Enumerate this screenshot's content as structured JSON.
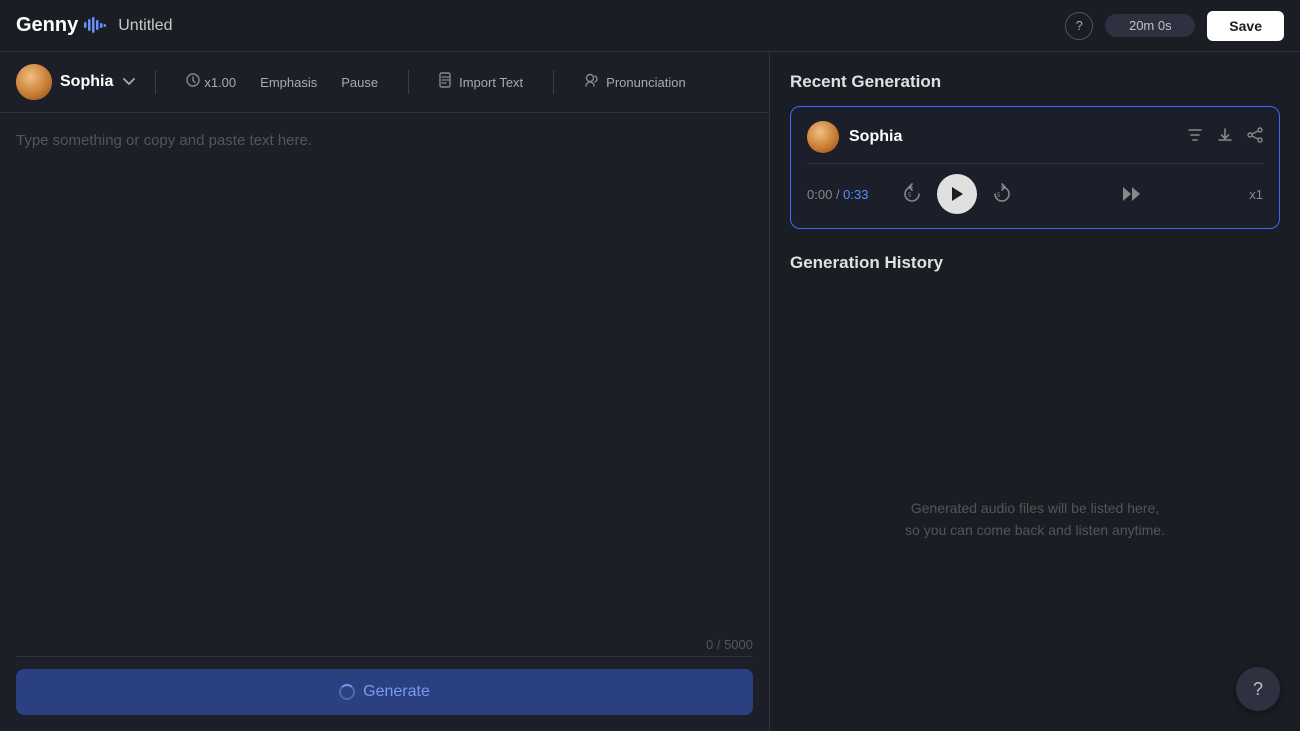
{
  "header": {
    "logo_text": "Genny",
    "logo_wave": "♪",
    "project_title": "Untitled",
    "time_display": "20m 0s",
    "save_label": "Save",
    "help_icon": "?"
  },
  "voice_bar": {
    "voice_name": "Sophia",
    "speed_label": "x1.00",
    "emphasis_label": "Emphasis",
    "pause_label": "Pause",
    "import_text_label": "Import Text",
    "pronunciation_label": "Pronunciation"
  },
  "text_area": {
    "placeholder": "Type something or copy and paste text here.",
    "char_count": "0 / 5000",
    "generate_label": "Generate"
  },
  "recent_generation": {
    "section_title": "Recent Generation",
    "voice_name": "Sophia",
    "time_current": "0:00",
    "time_separator": "/",
    "time_total": "0:33",
    "speed": "x1"
  },
  "generation_history": {
    "section_title": "Generation History",
    "empty_text_line1": "Generated audio files will be listed here,",
    "empty_text_line2": "so you can come back and listen anytime."
  },
  "icons": {
    "chevron_down": "⌄",
    "help": "?",
    "rewind": "↺",
    "forward": "↻",
    "fast_forward": "⏭",
    "text_icon": "T",
    "download_icon": "↓",
    "share_icon": "⇈",
    "play": "▶",
    "import": "📄",
    "pronunciation": "🔊",
    "clock": "⊙"
  }
}
